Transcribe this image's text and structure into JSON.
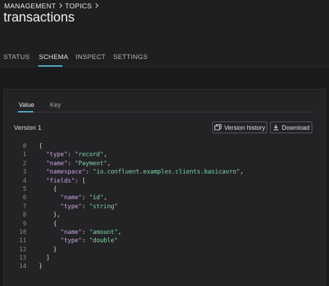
{
  "breadcrumb": {
    "items": [
      "MANAGEMENT",
      "TOPICS"
    ],
    "separator_icon": "chevron-right-icon"
  },
  "page": {
    "title": "transactions"
  },
  "tabs": [
    {
      "label": "STATUS",
      "active": false
    },
    {
      "label": "SCHEMA",
      "active": true
    },
    {
      "label": "INSPECT",
      "active": false
    },
    {
      "label": "SETTINGS",
      "active": false
    }
  ],
  "schema_panel": {
    "subtabs": [
      {
        "label": "Value",
        "active": true
      },
      {
        "label": "Key",
        "active": false
      }
    ],
    "version_label": "Version 1",
    "version_history_button": "Version history",
    "download_button": "Download",
    "code_lines": [
      {
        "n": "0",
        "parts": [
          {
            "t": "p",
            "v": "{"
          }
        ]
      },
      {
        "n": "1",
        "parts": [
          {
            "t": "k",
            "v": "  \"type\""
          },
          {
            "t": "p",
            "v": ": "
          },
          {
            "t": "s",
            "v": "\"record\""
          },
          {
            "t": "p",
            "v": ","
          }
        ]
      },
      {
        "n": "2",
        "parts": [
          {
            "t": "k",
            "v": "  \"name\""
          },
          {
            "t": "p",
            "v": ": "
          },
          {
            "t": "s",
            "v": "\"Payment\""
          },
          {
            "t": "p",
            "v": ","
          }
        ]
      },
      {
        "n": "3",
        "parts": [
          {
            "t": "k",
            "v": "  \"namespace\""
          },
          {
            "t": "p",
            "v": ": "
          },
          {
            "t": "s",
            "v": "\"io.confluent.examples.clients.basicavro\""
          },
          {
            "t": "p",
            "v": ","
          }
        ]
      },
      {
        "n": "4",
        "parts": [
          {
            "t": "k",
            "v": "  \"fields\""
          },
          {
            "t": "p",
            "v": ": ["
          }
        ]
      },
      {
        "n": "5",
        "parts": [
          {
            "t": "p",
            "v": "    {"
          }
        ]
      },
      {
        "n": "6",
        "parts": [
          {
            "t": "k",
            "v": "      \"name\""
          },
          {
            "t": "p",
            "v": ": "
          },
          {
            "t": "s",
            "v": "\"id\""
          },
          {
            "t": "p",
            "v": ","
          }
        ]
      },
      {
        "n": "7",
        "parts": [
          {
            "t": "k",
            "v": "      \"type\""
          },
          {
            "t": "p",
            "v": ": "
          },
          {
            "t": "s",
            "v": "\"string\""
          }
        ]
      },
      {
        "n": "8",
        "parts": [
          {
            "t": "p",
            "v": "    },"
          }
        ]
      },
      {
        "n": "9",
        "parts": [
          {
            "t": "p",
            "v": "    {"
          }
        ]
      },
      {
        "n": "10",
        "parts": [
          {
            "t": "k",
            "v": "      \"name\""
          },
          {
            "t": "p",
            "v": ": "
          },
          {
            "t": "s",
            "v": "\"amount\""
          },
          {
            "t": "p",
            "v": ","
          }
        ]
      },
      {
        "n": "11",
        "parts": [
          {
            "t": "k",
            "v": "      \"type\""
          },
          {
            "t": "p",
            "v": ": "
          },
          {
            "t": "s",
            "v": "\"double\""
          }
        ]
      },
      {
        "n": "12",
        "parts": [
          {
            "t": "p",
            "v": "    }"
          }
        ]
      },
      {
        "n": "13",
        "parts": [
          {
            "t": "p",
            "v": "  ]"
          }
        ]
      },
      {
        "n": "14",
        "parts": [
          {
            "t": "p",
            "v": "}"
          }
        ]
      }
    ]
  },
  "icons": {
    "version_history": "history-icon",
    "download": "download-icon"
  },
  "colors": {
    "background": "#1b1b1d",
    "accent": "#4fb1c9",
    "json_key": "#c9a4e6",
    "json_string": "#7fd6a6"
  }
}
